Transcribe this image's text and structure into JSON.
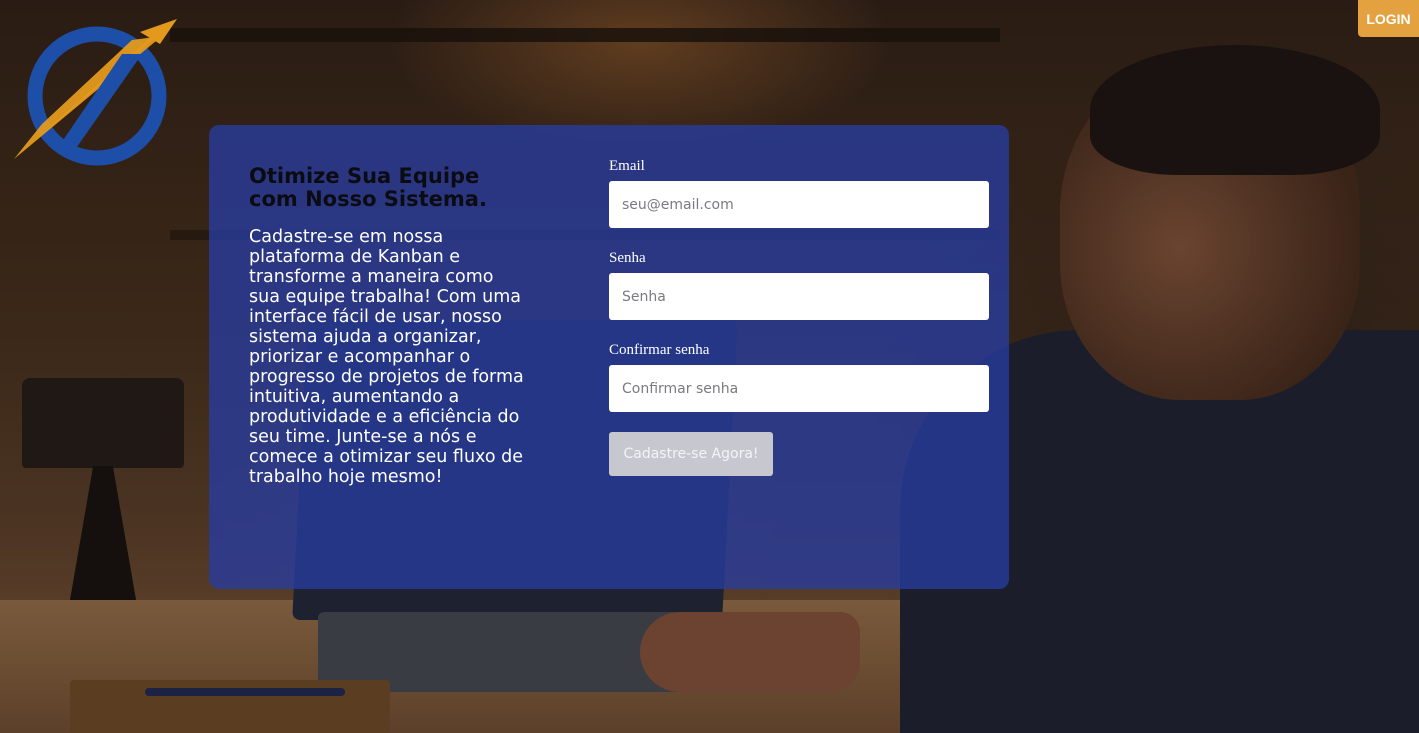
{
  "header": {
    "login_label": "LOGIN"
  },
  "hero": {
    "title": "Otimize Sua Equipe com Nosso Sistema.",
    "description": "Cadastre-se em nossa plataforma de Kanban e transforme a maneira como sua equipe trabalha! Com uma interface fácil de usar, nosso sistema ajuda a organizar, priorizar e acompanhar o progresso de projetos de forma intuitiva, aumentando a produtividade e a eficiência do seu time. Junte-se a nós e comece a otimizar seu fluxo de trabalho hoje mesmo!"
  },
  "form": {
    "email_label": "Email",
    "email_placeholder": "seu@email.com",
    "password_label": "Senha",
    "password_placeholder": "Senha",
    "confirm_label": "Confirmar senha",
    "confirm_placeholder": "Confirmar senha",
    "submit_label": "Cadastre-se Agora!"
  },
  "colors": {
    "accent": "#e3a13f",
    "card": "#283ca0",
    "logo_blue": "#1e4fa8",
    "logo_orange": "#e39a1c"
  },
  "icons": {
    "logo": "circle-arrow-logo"
  }
}
